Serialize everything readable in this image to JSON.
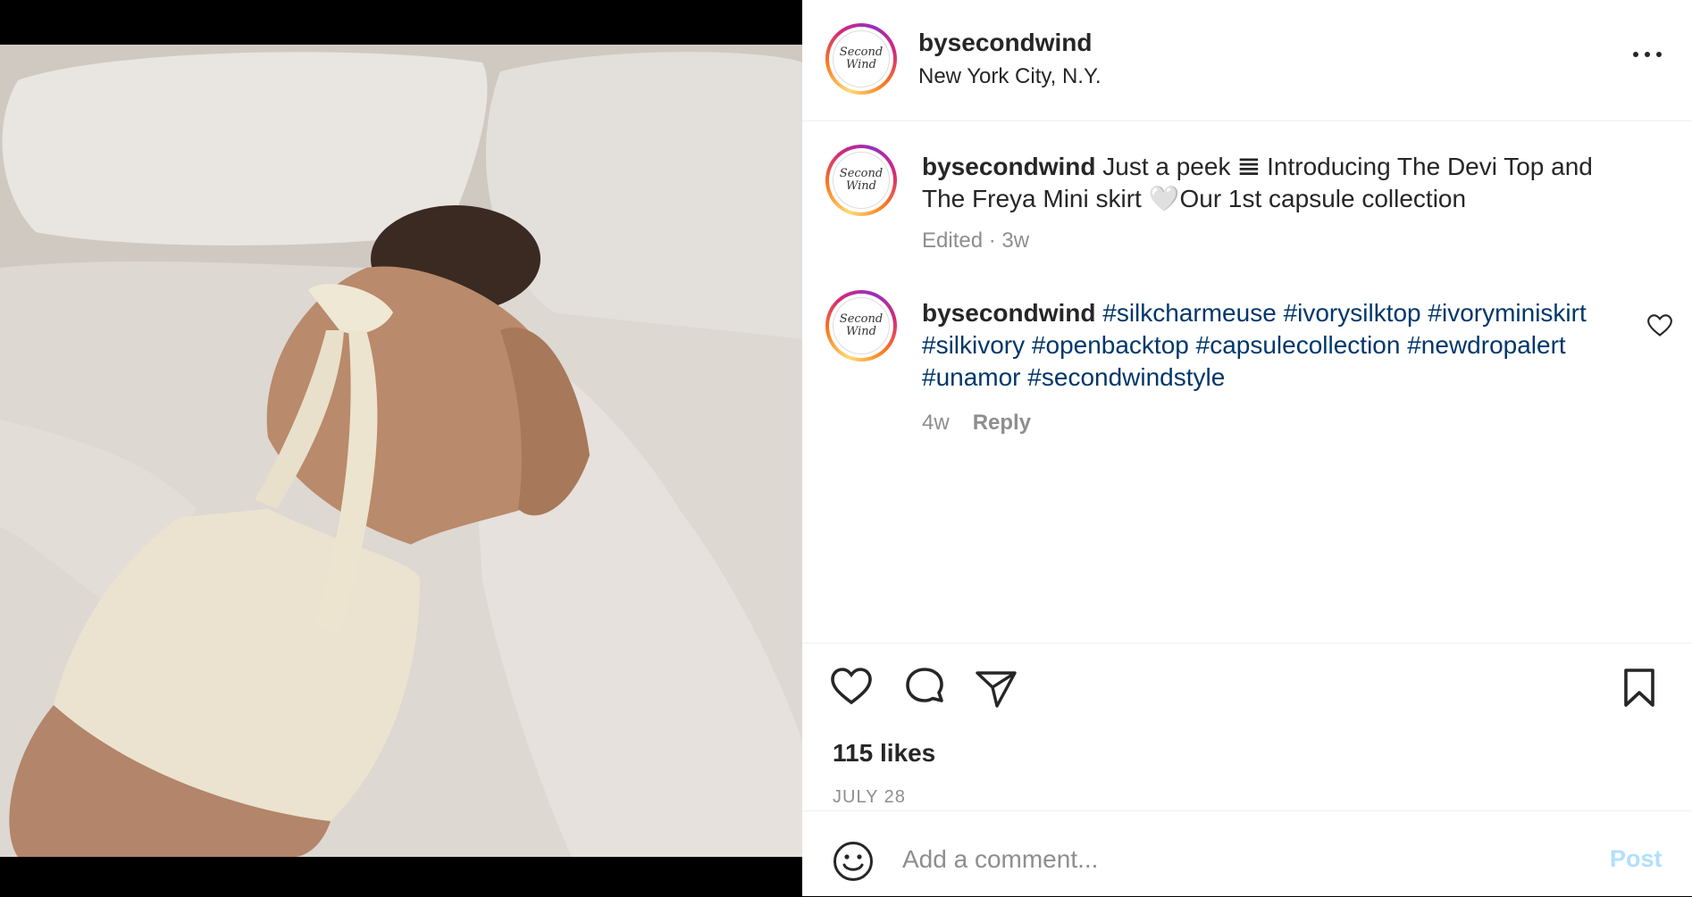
{
  "post": {
    "username": "bysecondwind",
    "location": "New York City, N.Y.",
    "avatar_text_1": "Second",
    "avatar_text_2": "Wind",
    "caption": {
      "username": "bysecondwind",
      "text_1": " Just a peek 𝌆 Introducing The Devi Top and The Freya Mini skirt 🤍Our 1st capsule collection",
      "meta": "Edited · 3w"
    },
    "comment": {
      "username": "bysecondwind",
      "hashtags": [
        "#silkcharmeuse",
        "#ivorysilktop",
        "#ivoryminiskirt",
        "#silkivory",
        "#openbacktop",
        "#capsulecollection",
        "#newdropalert",
        "#unamor",
        "#secondwindstyle"
      ],
      "age": "4w",
      "reply_label": "Reply"
    },
    "likes": "115 likes",
    "date": "JULY 28",
    "add_comment_placeholder": "Add a comment...",
    "post_label": "Post"
  },
  "icons": {
    "more": "more-icon",
    "heart": "heart-icon",
    "comment": "comment-icon",
    "share": "share-icon",
    "save": "bookmark-icon",
    "emoji": "emoji-icon",
    "small_heart": "heart-icon"
  },
  "colors": {
    "hashtag": "#00376b",
    "muted": "#8e8e8e",
    "post_disabled": "#b2dffc"
  }
}
